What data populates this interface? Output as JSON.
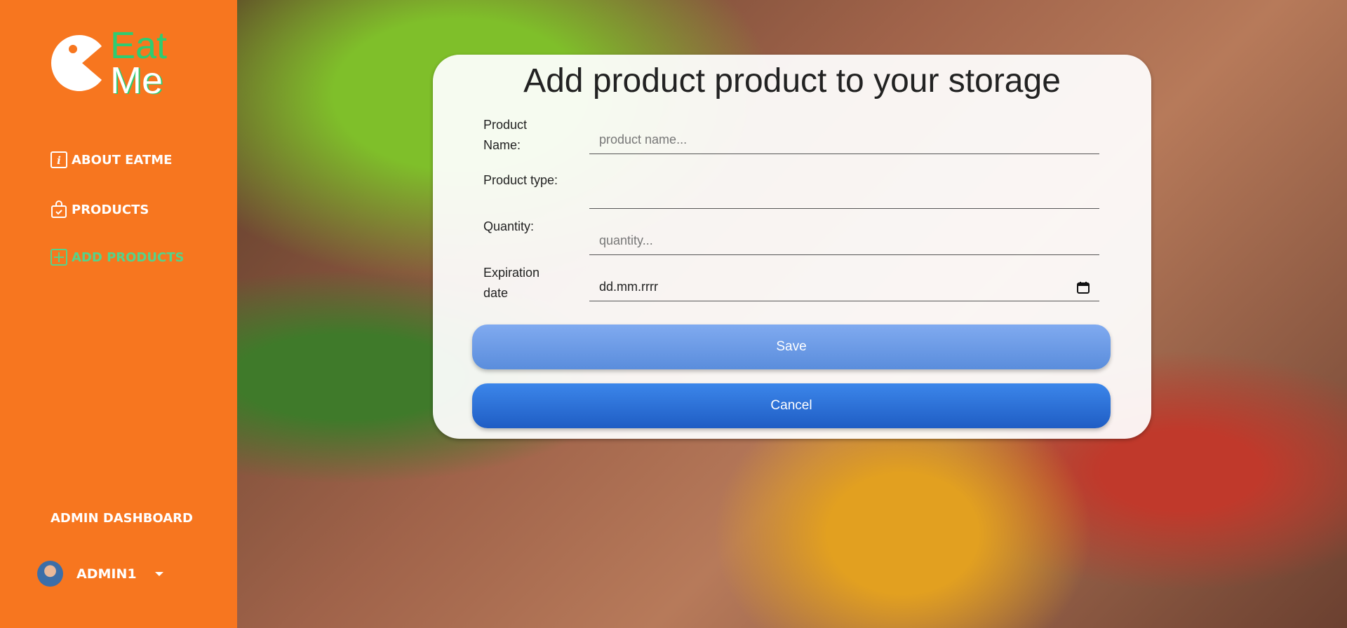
{
  "sidebar": {
    "logo": {
      "line1": "Eat",
      "line2": "Me"
    },
    "items": [
      {
        "label": "ABOUT EATME",
        "icon": "info-icon"
      },
      {
        "label": "PRODUCTS",
        "icon": "shopping-bag-check-icon"
      },
      {
        "label": "ADD PRODUCTS",
        "icon": "plus-square-icon",
        "active": true
      }
    ],
    "admin_dashboard": "ADMIN DASHBOARD",
    "user": {
      "name": "ADMIN1"
    }
  },
  "form": {
    "title": "Add product product to your storage",
    "fields": [
      {
        "label": "Product Name:",
        "placeholder": "product name...",
        "value": ""
      },
      {
        "label": "Product type:",
        "placeholder": "",
        "value": ""
      },
      {
        "label": "Quantity:",
        "placeholder": "quantity...",
        "value": ""
      },
      {
        "label": "Expiration date",
        "placeholder": "dd.mm.rrrr",
        "value": ""
      }
    ],
    "save_label": "Save",
    "cancel_label": "Cancel"
  },
  "colors": {
    "sidebar": "#f7761f",
    "accent_green": "#2ecc71",
    "save": "#6f9be6",
    "cancel": "#2a6fd8"
  }
}
